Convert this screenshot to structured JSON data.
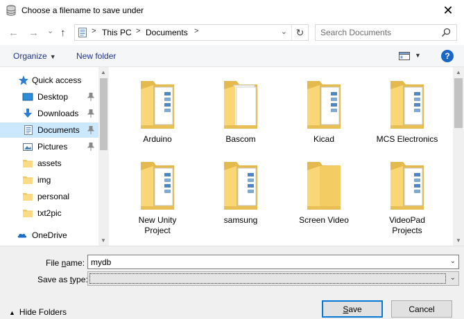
{
  "window": {
    "title": "Choose a filename to save under",
    "close_glyph": "✕"
  },
  "nav": {
    "back_glyph": "←",
    "forward_glyph": "→",
    "recent_glyph": "⌄",
    "up_glyph": "↑",
    "breadcrumbs": [
      "This PC",
      "Documents"
    ],
    "crumb_sep": ">",
    "refresh_glyph": "↻",
    "search_placeholder": "Search Documents"
  },
  "toolbar": {
    "organize_label": "Organize",
    "new_folder_label": "New folder",
    "help_label": "?"
  },
  "sidebar": {
    "items": [
      {
        "label": "Quick access",
        "icon": "star-icon"
      },
      {
        "label": "Desktop",
        "icon": "desktop-icon",
        "pinned": true
      },
      {
        "label": "Downloads",
        "icon": "download-icon",
        "pinned": true
      },
      {
        "label": "Documents",
        "icon": "documents-icon",
        "pinned": true,
        "selected": true
      },
      {
        "label": "Pictures",
        "icon": "pictures-icon",
        "pinned": true
      },
      {
        "label": "assets",
        "icon": "folder-icon"
      },
      {
        "label": "img",
        "icon": "folder-icon"
      },
      {
        "label": "personal",
        "icon": "folder-icon"
      },
      {
        "label": "txt2pic",
        "icon": "folder-icon"
      },
      {
        "label": "OneDrive",
        "icon": "cloud-icon"
      }
    ]
  },
  "files": [
    {
      "name": "Arduino",
      "icon": "folder-with-documents-icon"
    },
    {
      "name": "Bascom",
      "icon": "folder-with-papers-icon"
    },
    {
      "name": "Kicad",
      "icon": "folder-with-documents-icon"
    },
    {
      "name": "MCS Electronics",
      "icon": "folder-with-documents-icon"
    },
    {
      "name": "New Unity\nProject",
      "icon": "folder-with-documents-icon"
    },
    {
      "name": "samsung",
      "icon": "folder-with-documents-icon"
    },
    {
      "name": "Screen Video",
      "icon": "empty-folder-icon"
    },
    {
      "name": "VideoPad\nProjects",
      "icon": "folder-with-documents-icon"
    }
  ],
  "form": {
    "file_name_label_pre": "File ",
    "file_name_label_u": "n",
    "file_name_label_post": "ame:",
    "file_name_value": "mydb",
    "save_type_label_pre": "Save as ",
    "save_type_label_u": "t",
    "save_type_label_post": "ype:",
    "save_type_value": "",
    "hide_folders_label": "Hide Folders",
    "save_label_u": "S",
    "save_label_post": "ave",
    "cancel_label": "Cancel"
  },
  "colors": {
    "accent": "#0078d7",
    "selection": "#cce8ff",
    "link": "#1e3287",
    "folder": "#f8d775"
  }
}
